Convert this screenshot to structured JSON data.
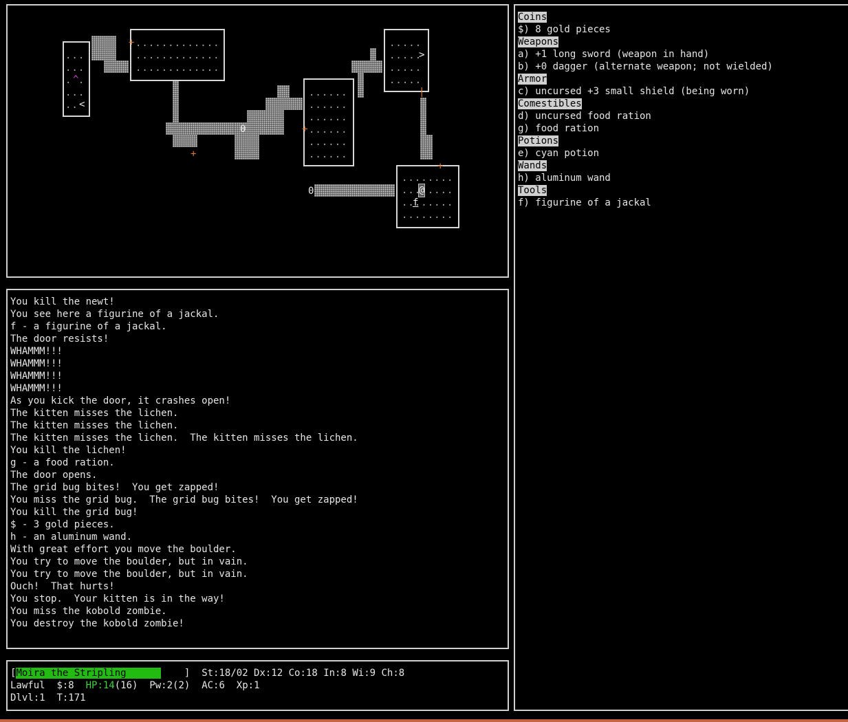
{
  "map": {
    "glyphs": {
      "upstairs": "<",
      "downstairs": ">",
      "boulder": "0",
      "door_open": "+",
      "door_broken": "|",
      "trap": "^",
      "player": "@",
      "pet": "f"
    }
  },
  "messages": [
    "You kill the newt!",
    "You see here a figurine of a jackal.",
    "f - a figurine of a jackal.",
    "The door resists!",
    "WHAMMM!!!",
    "WHAMMM!!!",
    "WHAMMM!!!",
    "WHAMMM!!!",
    "As you kick the door, it crashes open!",
    "The kitten misses the lichen.",
    "The kitten misses the lichen.",
    "The kitten misses the lichen.  The kitten misses the lichen.",
    "You kill the lichen!",
    "g - a food ration.",
    "The door opens.",
    "The grid bug bites!  You get zapped!",
    "You miss the grid bug.  The grid bug bites!  You get zapped!",
    "You kill the grid bug!",
    "$ - 3 gold pieces.",
    "h - an aluminum wand.",
    "With great effort you move the boulder.",
    "You try to move the boulder, but in vain.",
    "You try to move the boulder, but in vain.",
    "Ouch!  That hurts!",
    "You stop.  Your kitten is in the way!",
    "You miss the kobold zombie.",
    "You destroy the kobold zombie!"
  ],
  "inventory": [
    {
      "category": "Coins",
      "items": [
        "$) 8 gold pieces"
      ]
    },
    {
      "category": "Weapons",
      "items": [
        "a) +1 long sword (weapon in hand)",
        "b) +0 dagger (alternate weapon; not wielded)"
      ]
    },
    {
      "category": "Armor",
      "items": [
        "c) uncursed +3 small shield (being worn)"
      ]
    },
    {
      "category": "Comestibles",
      "items": [
        "d) uncursed food ration",
        "g) food ration"
      ]
    },
    {
      "category": "Potions",
      "items": [
        "e) cyan potion"
      ]
    },
    {
      "category": "Wands",
      "items": [
        "h) aluminum wand"
      ]
    },
    {
      "category": "Tools",
      "items": [
        "f) figurine of a jackal"
      ]
    }
  ],
  "status": {
    "open_bracket": "[",
    "name": "Moira the Stripling",
    "close_bracket": "]",
    "attributes": "St:18/02 Dx:12 Co:18 In:8 Wi:9 Ch:8",
    "alignment": "Lawful",
    "gold": "$:8",
    "hp_label": "HP:14",
    "hp_max": "(16)",
    "power": "Pw:2(2)",
    "ac": "AC:6",
    "xp": "Xp:1",
    "dlvl": "Dlvl:1",
    "turn": "T:171"
  },
  "colors": {
    "border": "#d0d0d0",
    "door": "#d87a3a",
    "trap": "#d040d0",
    "hp": "#3ed23e",
    "namebar": "#22bb11",
    "header_bg": "#d0d0d0"
  }
}
